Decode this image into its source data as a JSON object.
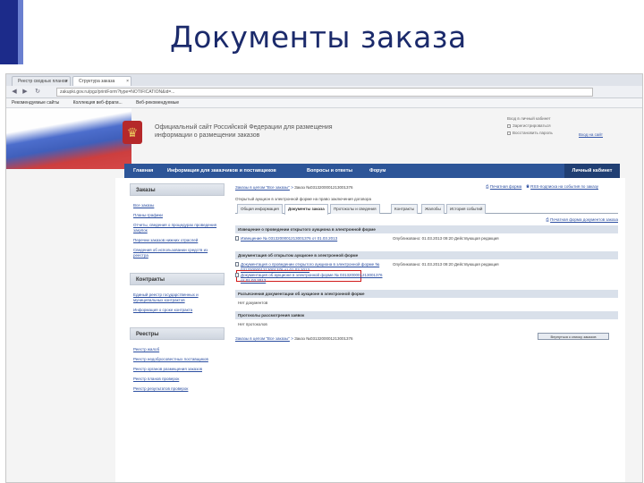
{
  "slide": {
    "title": "Документы заказа"
  },
  "browser": {
    "tabs": [
      {
        "label": "Реестр сводных планов"
      },
      {
        "label": "Структура заказа"
      }
    ],
    "url": "zakupki.gov.ru/pgz/printForm?type=NOTIFICATION&id=...",
    "bookmarks": [
      "Рекомендуемые сайты",
      "Коллекция веб-фрагм...",
      "Веб-рекомендуемые"
    ]
  },
  "site": {
    "name": "Официальный сайт Российской Федерации для размещения информации о размещении заказов",
    "header_right": {
      "line1": "Вход в личный кабинет",
      "line2": "Зарегистрироваться",
      "line3": "Восстановить пароль",
      "register_link": "Вход на сайт"
    }
  },
  "nav": {
    "items": [
      "Главная",
      "Информация для заказчиков и поставщиков",
      "Вопросы и ответы",
      "Форум"
    ],
    "cabinet": "Личный кабинет"
  },
  "sidebar": {
    "sections": [
      {
        "title": "Заказы",
        "items": [
          "Все заказы",
          "Планы-графики",
          "Отчеты, сведения о процедурах проведения закупок",
          "Перечни заказов нижних отраслей",
          "Сведения об использовании средств из реестра"
        ]
      },
      {
        "title": "Контракты",
        "items": [
          "Единый реестр государственных и муниципальных контрактов",
          "Информация о сроке контракта"
        ]
      },
      {
        "title": "Реестры",
        "items": [
          "Реестр жалоб",
          "Реестр недобросовестных поставщиков",
          "Реестр органов размещения заказов",
          "Реестр планов проверок",
          "Реестр результатов проверок"
        ]
      }
    ]
  },
  "panel": {
    "breadcrumb": {
      "link": "Заказы в целом \"Все заказы\"",
      "current": "Заказ №0313200001213001376"
    },
    "actions": {
      "print": "Печатная форма",
      "rss": "RSS-подписка на события по заказу"
    },
    "subline": "Открытый аукцион в электронной форме на право заключения договора",
    "tabs": [
      "Общая информация",
      "Документы заказа",
      "Протоколы и сведения",
      "Контракты",
      "Жалобы",
      "История событий"
    ],
    "active_tab": "Документы заказа",
    "print_link": "Печатная форма документов заказа",
    "sections": [
      {
        "title": "Извещение о проведении открытого аукциона в электронной форме",
        "rows": [
          {
            "left": "Извещение № 0313200001213001376 от 01.03.2013",
            "right": "Опубликовано: 01.03.2013 09:20 Действующая редакция"
          }
        ]
      },
      {
        "title": "Документация об открытом аукционе в электронной форме",
        "rows": [
          {
            "left": "Документация о проведении открытого аукциона в электронной форме № 0313200001213001376 от 01.03.2013",
            "right": "Опубликовано: 01.03.2013 09:20 Действующая редакция"
          },
          {
            "left": "Документация об аукционе в электронной форме № 0313200001213001376 от 01.03.2013",
            "right": ""
          }
        ]
      },
      {
        "title": "Разъяснения документации об аукционе в электронной форме",
        "text": "Нет документов"
      },
      {
        "title": "Протоколы рассмотрения заявок",
        "text": "Нет протоколов"
      }
    ],
    "footer": {
      "link": "Заказы в целом \"Все заказы\"",
      "current": "Заказ №0313200001213001376",
      "back_button": "Вернуться к списку заказов"
    }
  }
}
